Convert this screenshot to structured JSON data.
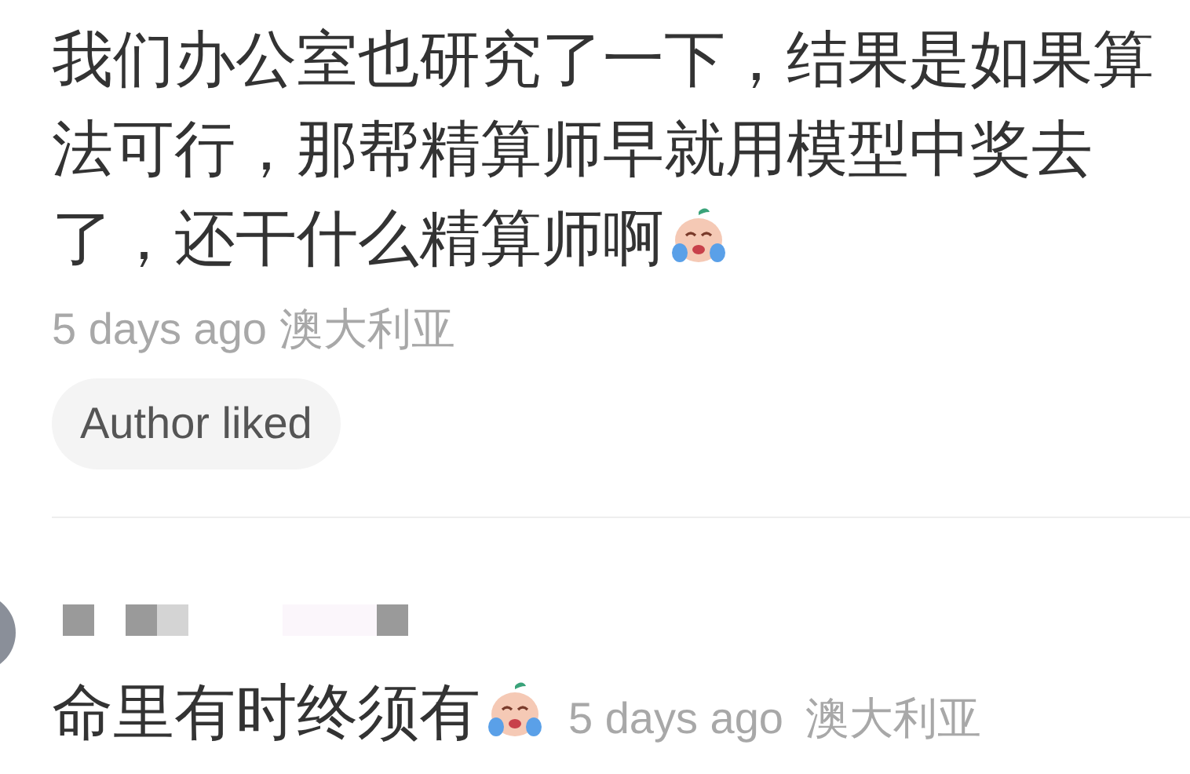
{
  "comments": [
    {
      "text": "我们办公室也研究了一下，结果是如果算法可行，那帮精算师早就用模型中奖去了，还干什么精算师啊",
      "time": "5 days ago",
      "location": "澳大利亚",
      "author_liked": "Author liked"
    },
    {
      "text": "命里有时终须有",
      "time": "5 days ago",
      "location": "澳大利亚"
    }
  ]
}
